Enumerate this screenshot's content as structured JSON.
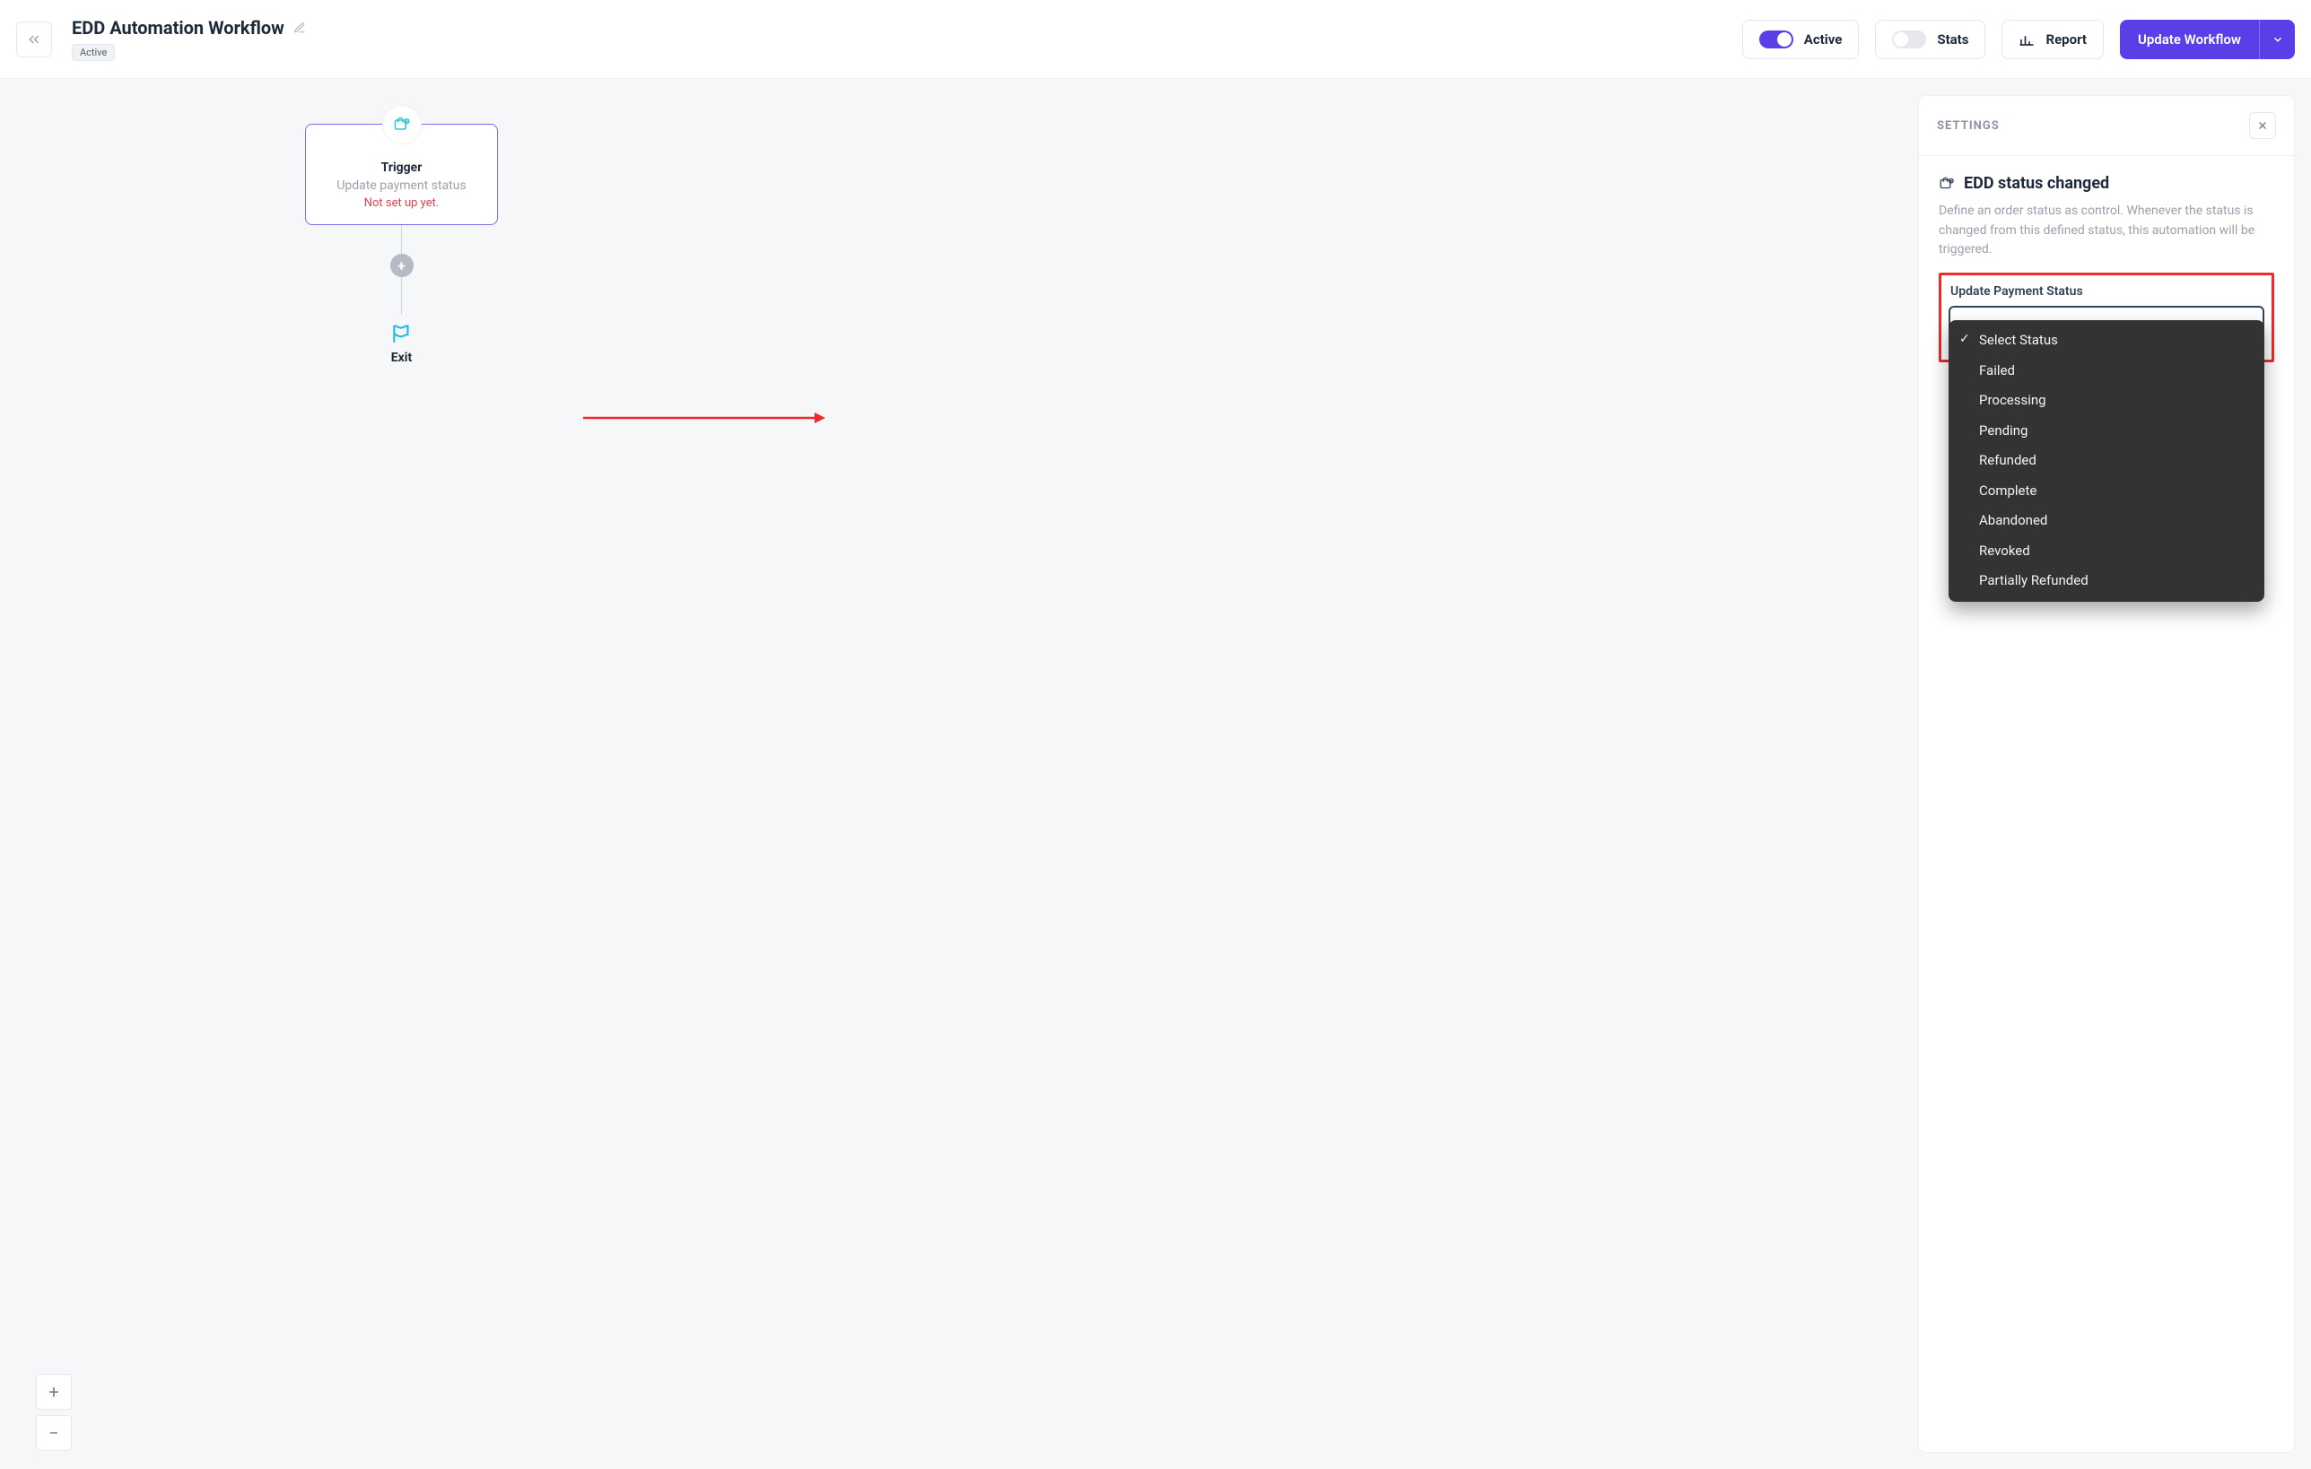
{
  "header": {
    "title": "EDD Automation Workflow",
    "tag": "Active",
    "active_label": "Active",
    "stats_label": "Stats",
    "report_label": "Report",
    "update_label": "Update Workflow"
  },
  "node": {
    "title": "Trigger",
    "subtitle": "Update payment status",
    "warning": "Not set up yet.",
    "exit_label": "Exit"
  },
  "panel": {
    "header": "SETTINGS",
    "title": "EDD status changed",
    "description": "Define an order status as control. Whenever the status is changed from this defined status, this automation will be triggered.",
    "field_label": "Update Payment Status",
    "options": [
      "Select Status",
      "Failed",
      "Processing",
      "Pending",
      "Refunded",
      "Complete",
      "Abandoned",
      "Revoked",
      "Partially Refunded"
    ],
    "selected_index": 0
  }
}
